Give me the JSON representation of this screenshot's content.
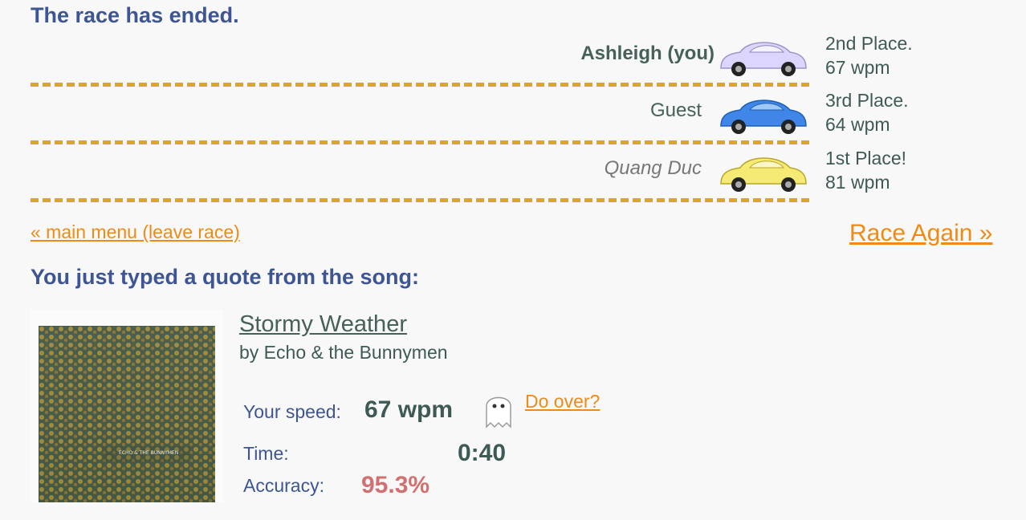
{
  "race": {
    "title": "The race has ended.",
    "lanes": [
      {
        "name": "Ashleigh (you)",
        "place": "2nd Place.",
        "wpm": "67 wpm",
        "car_color": "#dcd6ff"
      },
      {
        "name": "Guest",
        "place": "3rd Place.",
        "wpm": "64 wpm",
        "car_color": "#3f86e8"
      },
      {
        "name": "Quang Duc",
        "place": "1st Place!",
        "wpm": "81 wpm",
        "car_color": "#f4ea74"
      }
    ],
    "main_menu_link": "« main menu (leave race)",
    "race_again_link": "Race Again »"
  },
  "song": {
    "heading": "You just typed a quote from the song:",
    "title": "Stormy Weather",
    "artist": "by Echo & the Bunnymen",
    "album_art_text": "ECHO & THE BUNNYMEN"
  },
  "stats": {
    "speed_label": "Your speed:",
    "speed_value": "67 wpm",
    "do_over_link": "Do over?",
    "time_label": "Time:",
    "time_value": "0:40",
    "accuracy_label": "Accuracy:",
    "accuracy_value": "95.3%"
  },
  "colors": {
    "heading": "#3d5593",
    "link": "#f08a16",
    "track_dash": "#d9a52a",
    "accuracy": "#d27070"
  },
  "icons": [
    "car-icon",
    "ghost-icon"
  ]
}
